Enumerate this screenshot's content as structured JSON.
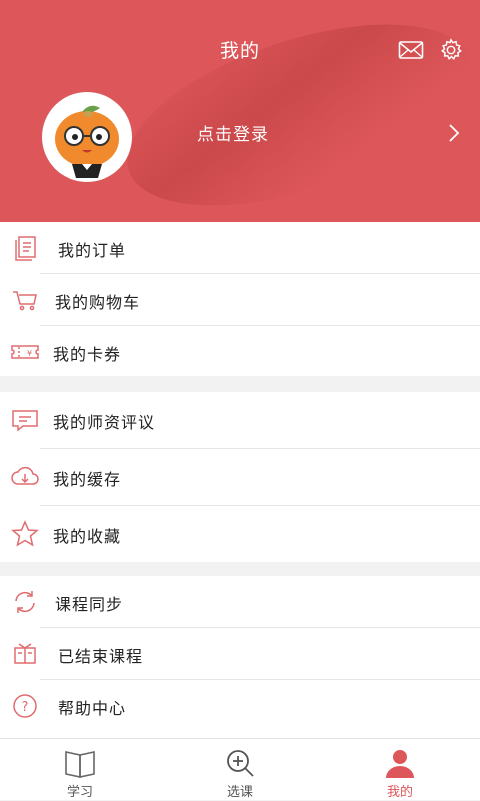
{
  "header": {
    "title": "我的",
    "login_prompt": "点击登录"
  },
  "menu_groups": [
    {
      "items": [
        {
          "label": "我的订单",
          "icon": "orders-icon"
        },
        {
          "label": "我的购物车",
          "icon": "cart-icon"
        },
        {
          "label": "我的卡券",
          "icon": "coupon-icon"
        }
      ]
    },
    {
      "items": [
        {
          "label": "我的师资评议",
          "icon": "comment-icon"
        },
        {
          "label": "我的缓存",
          "icon": "cloud-download-icon"
        },
        {
          "label": "我的收藏",
          "icon": "star-icon"
        }
      ]
    },
    {
      "items": [
        {
          "label": "课程同步",
          "icon": "sync-icon"
        },
        {
          "label": "已结束课程",
          "icon": "book-icon"
        },
        {
          "label": "帮助中心",
          "icon": "help-icon"
        }
      ]
    }
  ],
  "tabbar": {
    "tabs": [
      {
        "label": "学习",
        "icon": "open-book-icon",
        "active": false
      },
      {
        "label": "选课",
        "icon": "search-plus-icon",
        "active": false
      },
      {
        "label": "我的",
        "icon": "user-icon",
        "active": true
      }
    ]
  },
  "colors": {
    "accent": "#dd575a",
    "icon_stroke": "#e06b6e",
    "text": "#222222"
  }
}
